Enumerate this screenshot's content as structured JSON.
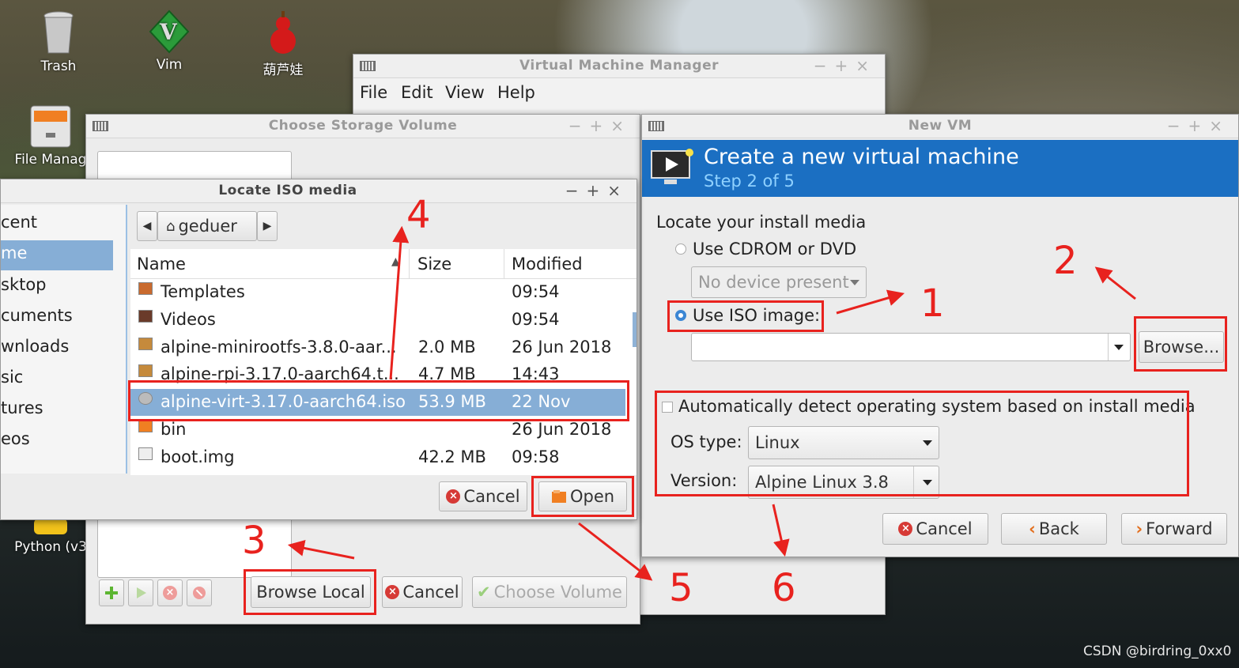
{
  "desktop": {
    "icons": {
      "trash": "Trash",
      "vim": "Vim",
      "calabash": "葫芦娃",
      "file_manager": "File Manag",
      "python": "Python (v3"
    },
    "watermark": "CSDN @birdring_0xx0"
  },
  "vmm": {
    "title": "Virtual Machine Manager",
    "menu": [
      "File",
      "Edit",
      "View",
      "Help"
    ]
  },
  "storage": {
    "title": "Choose Storage Volume",
    "browse_local": "Browse Local",
    "cancel": "Cancel",
    "choose_volume": "Choose Volume"
  },
  "iso": {
    "title": "Locate ISO media",
    "path": "geduer",
    "sidebar": [
      "cent",
      "me",
      "sktop",
      "cuments",
      "wnloads",
      "sic",
      "tures",
      "eos"
    ],
    "columns": {
      "name": "Name",
      "size": "Size",
      "modified": "Modified"
    },
    "files": [
      {
        "name": "Templates",
        "size": "",
        "modified": "09:54",
        "icon": "folder-templates-icon"
      },
      {
        "name": "Videos",
        "size": "",
        "modified": "09:54",
        "icon": "folder-videos-icon"
      },
      {
        "name": "alpine-minirootfs-3.8.0-aar...",
        "size": "2.0 MB",
        "modified": "26 Jun 2018",
        "icon": "archive-icon"
      },
      {
        "name": "alpine-rpi-3.17.0-aarch64.t...",
        "size": "4.7 MB",
        "modified": "14:43",
        "icon": "archive-icon"
      },
      {
        "name": "alpine-virt-3.17.0-aarch64.iso",
        "size": "53.9 MB",
        "modified": "22 Nov",
        "icon": "disc-icon"
      },
      {
        "name": "bin",
        "size": "",
        "modified": "26 Jun 2018",
        "icon": "folder-icon"
      },
      {
        "name": "boot.img",
        "size": "42.2 MB",
        "modified": "09:58",
        "icon": "file-icon"
      }
    ],
    "cancel": "Cancel",
    "open": "Open"
  },
  "newvm": {
    "title": "New VM",
    "header_title": "Create a new virtual machine",
    "header_step": "Step 2 of 5",
    "locate_label": "Locate your install media",
    "cdrom_label": "Use CDROM or DVD",
    "no_device": "No device present",
    "iso_label": "Use ISO image:",
    "iso_value": "",
    "browse": "Browse...",
    "auto_detect": "Automatically detect operating system based on install media",
    "os_type_label": "OS type:",
    "os_type_value": "Linux",
    "version_label": "Version:",
    "version_value": "Alpine Linux 3.8",
    "cancel": "Cancel",
    "back": "Back",
    "forward": "Forward"
  },
  "annotations": [
    "1",
    "2",
    "3",
    "4",
    "5",
    "6"
  ],
  "colors": {
    "annotation": "#e8221e",
    "selection": "#86aed6",
    "header": "#1b6fc2"
  }
}
